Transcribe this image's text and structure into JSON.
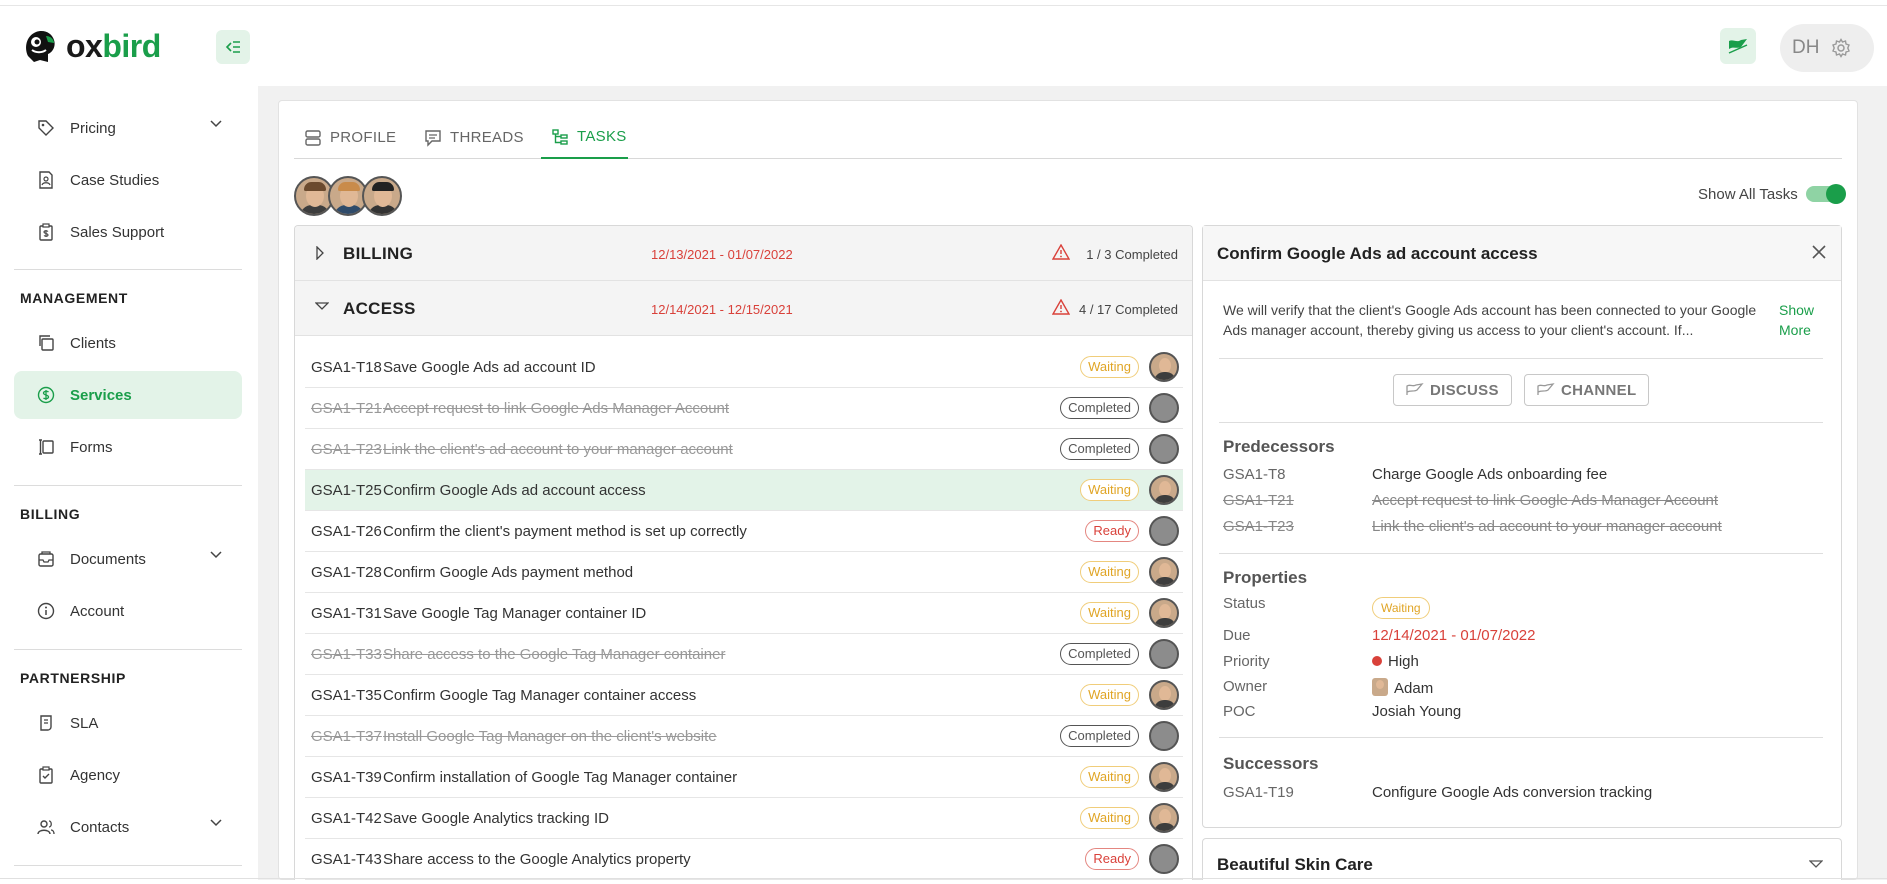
{
  "brand": {
    "name_part1": "ox",
    "name_part2": "bird"
  },
  "header": {
    "user_initials": "DH"
  },
  "sidebar": {
    "top_items": [
      {
        "label": "Pricing",
        "icon": "tag-icon",
        "has_chevron": true
      },
      {
        "label": "Case Studies",
        "icon": "document-user-icon"
      },
      {
        "label": "Sales Support",
        "icon": "clipboard-dollar-icon"
      }
    ],
    "management": {
      "title": "MANAGEMENT",
      "items": [
        {
          "label": "Clients",
          "icon": "copy-icon"
        },
        {
          "label": "Services",
          "icon": "dollar-circle-icon",
          "active": true
        },
        {
          "label": "Forms",
          "icon": "form-icon"
        }
      ]
    },
    "billing": {
      "title": "BILLING",
      "items": [
        {
          "label": "Documents",
          "icon": "inbox-icon",
          "has_chevron": true
        },
        {
          "label": "Account",
          "icon": "info-circle-icon"
        }
      ]
    },
    "partnership": {
      "title": "PARTNERSHIP",
      "items": [
        {
          "label": "SLA",
          "icon": "scroll-icon"
        },
        {
          "label": "Agency",
          "icon": "clipboard-check-icon"
        },
        {
          "label": "Contacts",
          "icon": "users-icon",
          "has_chevron": true
        }
      ]
    }
  },
  "tabs": [
    {
      "label": "PROFILE",
      "icon": "server-icon"
    },
    {
      "label": "THREADS",
      "icon": "chat-icon"
    },
    {
      "label": "TASKS",
      "icon": "hierarchy-icon",
      "active": true
    }
  ],
  "show_all_tasks": {
    "label": "Show All Tasks",
    "on": true
  },
  "groups": [
    {
      "name": "BILLING",
      "dates": "12/13/2021 - 01/07/2022",
      "count": "1 / 3 Completed",
      "expanded": false
    },
    {
      "name": "ACCESS",
      "dates": "12/14/2021 - 12/15/2021",
      "count": "4 / 17 Completed",
      "expanded": true
    }
  ],
  "tasks": [
    {
      "id": "GSA1-T18",
      "name": "Save Google Ads ad account ID",
      "status": "Waiting",
      "done": false,
      "assignee": "person"
    },
    {
      "id": "GSA1-T21",
      "name": "Accept request to link Google Ads Manager Account",
      "status": "Completed",
      "done": true,
      "assignee": "grey"
    },
    {
      "id": "GSA1-T23",
      "name": "Link the client's ad account to your manager account",
      "status": "Completed",
      "done": true,
      "assignee": "grey"
    },
    {
      "id": "GSA1-T25",
      "name": "Confirm Google Ads ad account access",
      "status": "Waiting",
      "done": false,
      "assignee": "person",
      "selected": true
    },
    {
      "id": "GSA1-T26",
      "name": "Confirm the client's payment method is set up correctly",
      "status": "Ready",
      "done": false,
      "assignee": "grey"
    },
    {
      "id": "GSA1-T28",
      "name": "Confirm Google Ads payment method",
      "status": "Waiting",
      "done": false,
      "assignee": "person"
    },
    {
      "id": "GSA1-T31",
      "name": "Save Google Tag Manager container ID",
      "status": "Waiting",
      "done": false,
      "assignee": "person"
    },
    {
      "id": "GSA1-T33",
      "name": "Share access to the Google Tag Manager container",
      "status": "Completed",
      "done": true,
      "assignee": "grey"
    },
    {
      "id": "GSA1-T35",
      "name": "Confirm Google Tag Manager container access",
      "status": "Waiting",
      "done": false,
      "assignee": "person"
    },
    {
      "id": "GSA1-T37",
      "name": "Install Google Tag Manager on the client's website",
      "status": "Completed",
      "done": true,
      "assignee": "grey"
    },
    {
      "id": "GSA1-T39",
      "name": "Confirm installation of Google Tag Manager container",
      "status": "Waiting",
      "done": false,
      "assignee": "person"
    },
    {
      "id": "GSA1-T42",
      "name": "Save Google Analytics tracking ID",
      "status": "Waiting",
      "done": false,
      "assignee": "person"
    },
    {
      "id": "GSA1-T43",
      "name": "Share access to the Google Analytics property",
      "status": "Ready",
      "done": false,
      "assignee": "grey"
    }
  ],
  "detail": {
    "title": "Confirm Google Ads ad account access",
    "description": "We will verify that the client's Google Ads account has been connected to your Google Ads manager account, thereby giving us access to your client's account. If...",
    "show_more": "Show More",
    "discuss_label": "DISCUSS",
    "channel_label": "CHANNEL",
    "predecessors_title": "Predecessors",
    "predecessors": [
      {
        "id": "GSA1-T8",
        "name": "Charge Google Ads onboarding fee",
        "done": false
      },
      {
        "id": "GSA1-T21",
        "name": "Accept request to link Google Ads Manager Account",
        "done": true
      },
      {
        "id": "GSA1-T23",
        "name": "Link the client's ad account to your manager account",
        "done": true
      }
    ],
    "properties_title": "Properties",
    "properties": {
      "status_label": "Status",
      "status_value": "Waiting",
      "due_label": "Due",
      "due_value": "12/14/2021 - 01/07/2022",
      "priority_label": "Priority",
      "priority_value": "High",
      "owner_label": "Owner",
      "owner_value": "Adam",
      "poc_label": "POC",
      "poc_value": "Josiah Young"
    },
    "successors_title": "Successors",
    "successors": [
      {
        "id": "GSA1-T19",
        "name": "Configure Google Ads conversion tracking"
      }
    ]
  },
  "next_panel": {
    "title": "Beautiful Skin Care"
  },
  "colors": {
    "brand_green": "#1a9e4a",
    "waiting": "#e0a526",
    "ready": "#d9413a",
    "selected_bg": "#e3f3e8"
  }
}
